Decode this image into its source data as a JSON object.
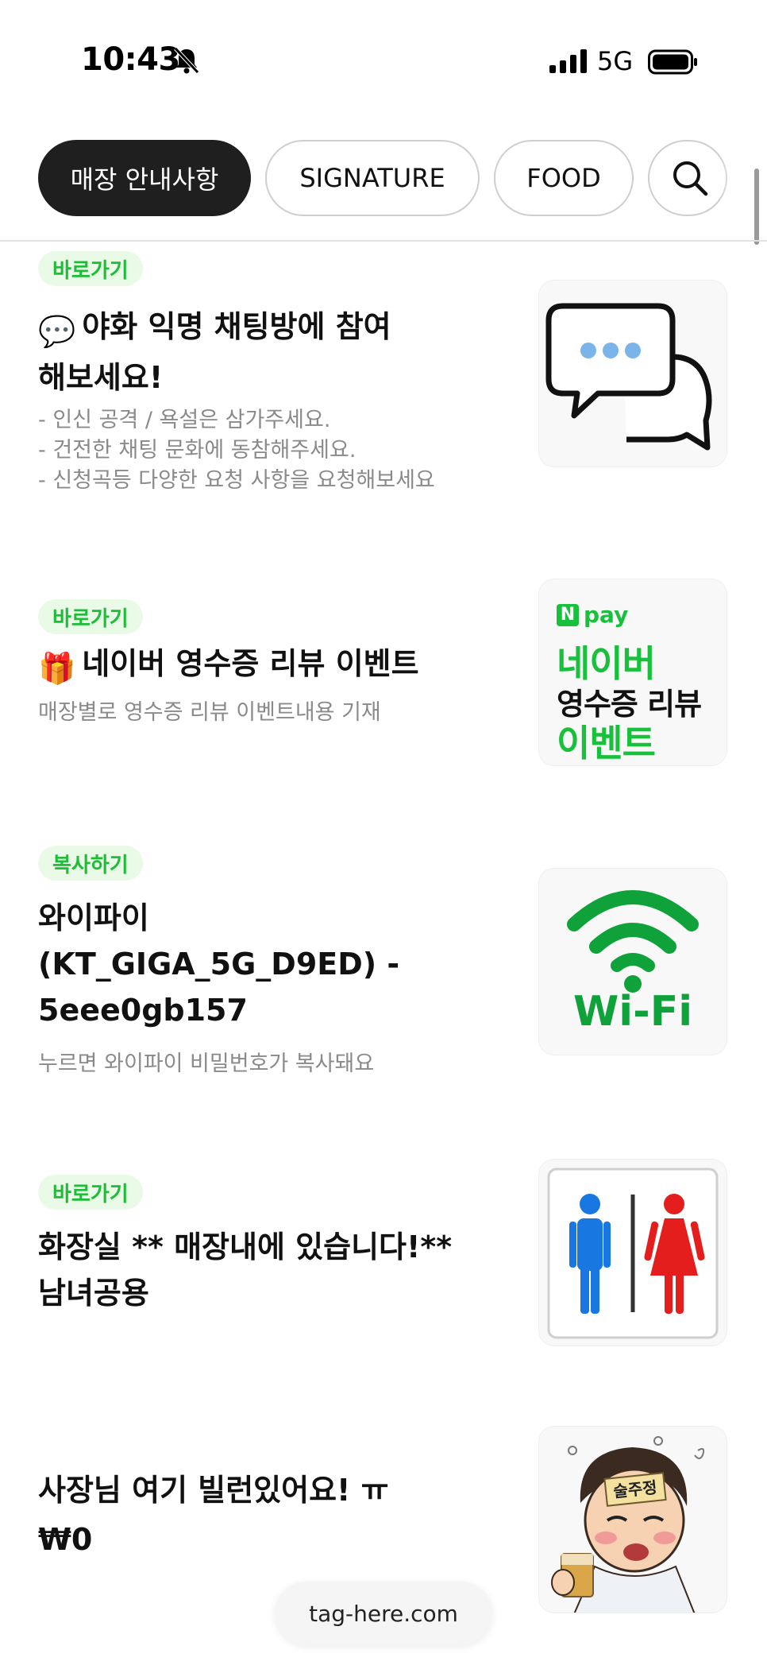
{
  "status_bar": {
    "time": "10:43",
    "network": "5G",
    "icons": [
      "bell-off-icon",
      "signal-icon",
      "battery-icon"
    ]
  },
  "tabs": [
    {
      "label": "매장 안내사항",
      "active": true
    },
    {
      "label": "SIGNATURE",
      "active": false
    },
    {
      "label": "FOOD",
      "active": false
    }
  ],
  "items": [
    {
      "badge": "바로가기",
      "emoji": "💬",
      "title": "야화 익명 채팅방에 참여 해보세요!",
      "desc": [
        "- 인신 공격 / 욕설은 삼가주세요.",
        "- 건전한 채팅 문화에 동참해주세요.",
        "- 신청곡등 다양한 요청 사항을 요청해보세요"
      ],
      "thumb_icon": "chat-bubble-icon"
    },
    {
      "badge": "바로가기",
      "emoji": "🎁",
      "title": "네이버 영수증 리뷰 이벤트",
      "desc": [
        "매장별로 영수증 리뷰 이벤트내용 기재"
      ],
      "thumb": {
        "brand": "pay",
        "line1": "네이버",
        "line2": "영수증 리뷰",
        "line3": "이벤트"
      }
    },
    {
      "badge": "복사하기",
      "title": "와이파이 (KT_GIGA_5G_D9ED) - 5eee0gb157",
      "desc": [
        "누르면 와이파이 비밀번호가 복사돼요"
      ],
      "thumb": {
        "label": "Wi-Fi"
      },
      "thumb_icon": "wifi-icon"
    },
    {
      "badge": "바로가기",
      "title": "화장실 ** 매장내에 있습니다!** 남녀공용",
      "thumb_icon": "restroom-icon"
    },
    {
      "title": "사장님 여기 빌런있어요! ㅠ",
      "price": "₩0",
      "thumb": {
        "sign_text": "술주정"
      },
      "thumb_icon": "drunk-man-illustration"
    }
  ],
  "footer": {
    "domain": "tag-here.com"
  },
  "colors": {
    "accent": "#1ebd37",
    "badge_bg": "#e9fbe6",
    "tab_active": "#1f1f1f"
  }
}
